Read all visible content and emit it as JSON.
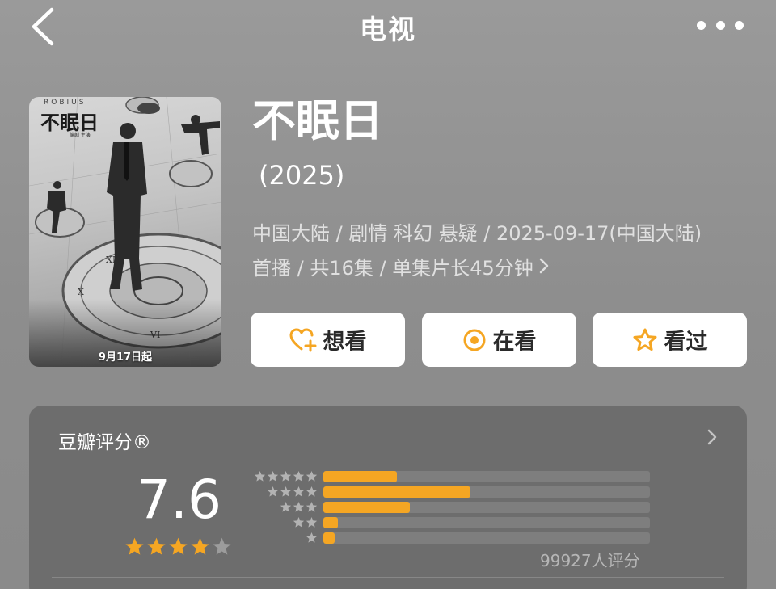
{
  "nav": {
    "title": "电视"
  },
  "poster": {
    "brand": "ROBIUS",
    "title": "不眠日",
    "subtitle": "编剧 主演",
    "date": "9月17日起"
  },
  "show": {
    "title": "不眠日",
    "year": "(2025)",
    "meta_line1": "中国大陆 / 剧情 科幻 悬疑 / 2025-09-17(中国大陆)",
    "meta_line2": "首播 / 共16集 / 单集片长45分钟",
    "meta_more_icon": "chevron-right-icon"
  },
  "actions": [
    {
      "label": "想看",
      "icon": "heart-plus-icon"
    },
    {
      "label": "在看",
      "icon": "target-icon"
    },
    {
      "label": "看过",
      "icon": "star-outline-icon"
    }
  ],
  "rating": {
    "heading": "豆瓣评分®",
    "score": "7.6",
    "star_rating": 4,
    "star_max": 5,
    "count": "99927人评分",
    "accent_color": "#f5a623",
    "distribution": [
      {
        "stars": 5,
        "fraction": 0.225
      },
      {
        "stars": 4,
        "fraction": 0.45
      },
      {
        "stars": 3,
        "fraction": 0.265
      },
      {
        "stars": 2,
        "fraction": 0.045
      },
      {
        "stars": 1,
        "fraction": 0.035
      }
    ]
  }
}
